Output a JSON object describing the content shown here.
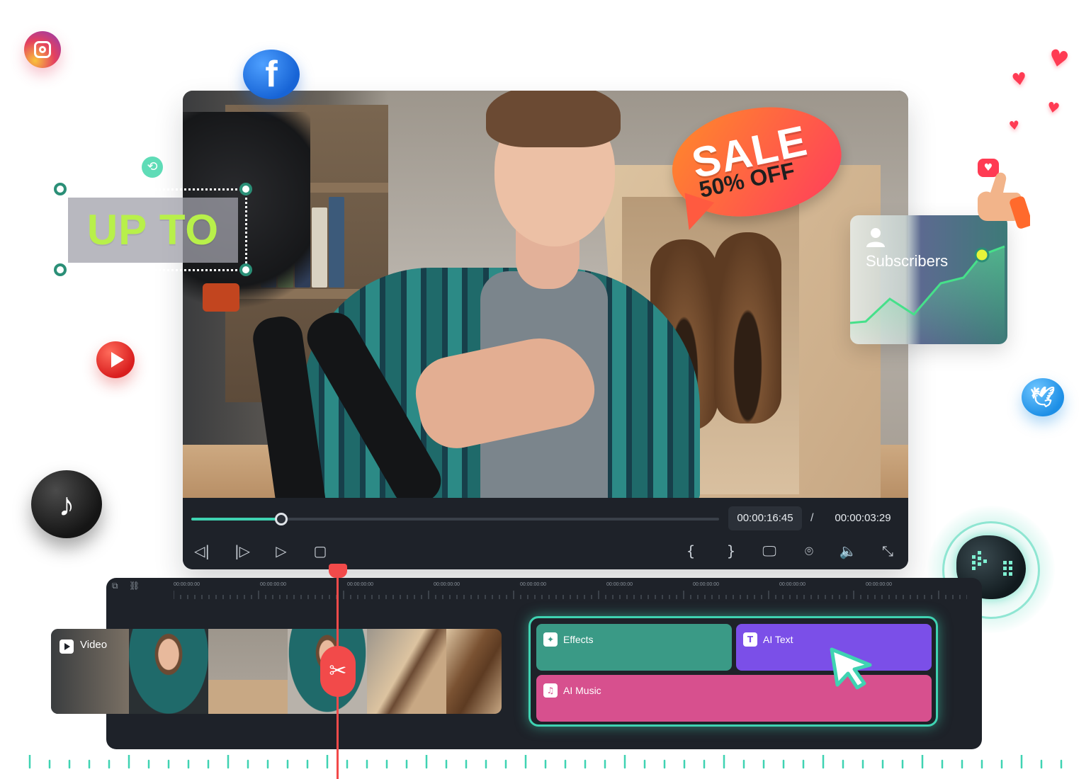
{
  "player": {
    "current_time": "00:00:16:45",
    "separator": "/",
    "total_time": "00:00:03:29",
    "progress": 0.17,
    "controls": [
      {
        "name": "prev-frame-icon",
        "glyph": "◁|"
      },
      {
        "name": "next-frame-icon",
        "glyph": "|▷"
      },
      {
        "name": "play-icon",
        "glyph": "▷"
      },
      {
        "name": "stop-icon",
        "glyph": "▢"
      },
      {
        "name": "mark-in-icon",
        "glyph": "{"
      },
      {
        "name": "mark-out-icon",
        "glyph": "}"
      },
      {
        "name": "display-icon",
        "glyph": "🖵"
      },
      {
        "name": "snapshot-icon",
        "glyph": "⌾"
      },
      {
        "name": "volume-icon",
        "glyph": "🔈"
      },
      {
        "name": "fullscreen-icon",
        "glyph": "⤡"
      }
    ]
  },
  "sale_badge": {
    "title": "SALE",
    "subtitle": "50% OFF"
  },
  "overlay_text": {
    "text": "UP TO"
  },
  "subscribers_card": {
    "label": "Subscribers"
  },
  "timeline": {
    "tick_labels": [
      "00:00:00:00",
      "00:00:00:00",
      "00:00:00:00",
      "00:00:00:00",
      "00:00:00:00",
      "00:00:00:00",
      "00:00:00:00",
      "00:00:00:00",
      "00:00:00:00"
    ],
    "video_track": {
      "label": "Video"
    },
    "ai_clips": {
      "effects": "Effects",
      "ai_text": "AI Text",
      "ai_music": "AI Music"
    }
  },
  "colors": {
    "accent": "#3fd3b2",
    "effects_clip": "#3a9a86",
    "ai_text_clip": "#7b4fe8",
    "ai_music_clip": "#d7508e",
    "playhead": "#f24a4a",
    "overlay_text": "#b8f04a"
  },
  "icons": {
    "social": [
      "instagram-icon",
      "facebook-icon",
      "youtube-icon",
      "tiktok-icon",
      "twitter-icon"
    ]
  }
}
